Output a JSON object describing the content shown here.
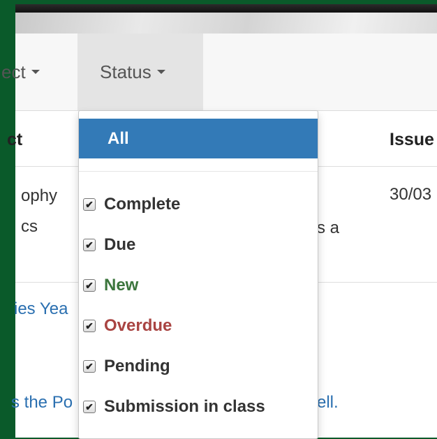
{
  "toolbar": {
    "subject_label": "ect",
    "status_label": "Status"
  },
  "table": {
    "headers": [
      "ct",
      "Issue"
    ],
    "row1": {
      "subject_lines": [
        "ophy",
        "cs"
      ],
      "title_fragment": "s a",
      "issued": "30/03"
    },
    "row2_fragment": "ies Yea",
    "row3_fragment": "s the Po",
    "row3_tail": "ell."
  },
  "status_menu": {
    "all_label": "All",
    "items": [
      {
        "label": "Complete",
        "checked": true,
        "color": "#333333"
      },
      {
        "label": "Due",
        "checked": true,
        "color": "#333333"
      },
      {
        "label": "New",
        "checked": true,
        "color": "#3c763d"
      },
      {
        "label": "Overdue",
        "checked": true,
        "color": "#a94442"
      },
      {
        "label": "Pending",
        "checked": true,
        "color": "#333333"
      },
      {
        "label": "Submission in class",
        "checked": true,
        "color": "#333333"
      }
    ],
    "check_glyph": "✔"
  },
  "colors": {
    "frame": "#0a5a2a",
    "accent": "#337ab7",
    "link": "#2a6fb0"
  }
}
